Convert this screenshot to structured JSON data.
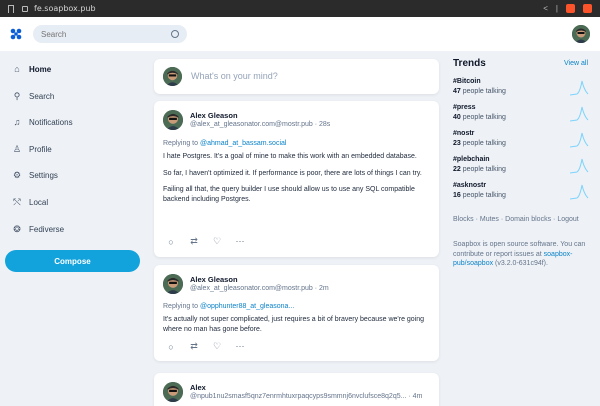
{
  "browser": {
    "url": "fe.soapbox.pub"
  },
  "search": {
    "placeholder": "Search"
  },
  "nav": [
    {
      "label": "Home",
      "icon": "home-icon",
      "glyph": "⌂"
    },
    {
      "label": "Search",
      "icon": "search-icon",
      "glyph": "⚲"
    },
    {
      "label": "Notifications",
      "icon": "bell-icon",
      "glyph": "♫"
    },
    {
      "label": "Profile",
      "icon": "user-icon",
      "glyph": "♙"
    },
    {
      "label": "Settings",
      "icon": "gear-icon",
      "glyph": "⚙"
    },
    {
      "label": "Local",
      "icon": "local-icon",
      "glyph": "⤲"
    },
    {
      "label": "Fediverse",
      "icon": "fediverse-icon",
      "glyph": "❂"
    }
  ],
  "compose_label": "Compose",
  "composer": {
    "placeholder": "What's on your mind?"
  },
  "posts": [
    {
      "name": "Alex Gleason",
      "handle": "@alex_at_gleasonator.com@mostr.pub · 28s",
      "reply_prefix": "Replying to ",
      "reply_to": "@ahmad_at_bassam.social",
      "paragraphs": [
        "I hate Postgres. It's a goal of mine to make this work with an embedded database.",
        "So far, I haven't optimized it. If performance is poor, there are lots of things I can try.",
        "Failing all that, the query builder I use should allow us to use any SQL compatible backend including Postgres."
      ]
    },
    {
      "name": "Alex Gleason",
      "handle": "@alex_at_gleasonator.com@mostr.pub · 2m",
      "reply_prefix": "Replying to ",
      "reply_to": "@opphunter88_at_gleasona...",
      "paragraphs": [
        "It's actually not super complicated, just requires a bit of bravery because we're going where no man has gone before."
      ]
    },
    {
      "name": "Alex",
      "handle": "@npub1nu2smasf5qnz7enrmhtuxrpaqcyps9smmnj6nvclufsce8q2q5... · 4m"
    }
  ],
  "trends": {
    "title": "Trends",
    "view_all": "View all",
    "items": [
      {
        "tag": "#Bitcoin",
        "count": "47",
        "suffix": " people talking"
      },
      {
        "tag": "#press",
        "count": "40",
        "suffix": " people talking"
      },
      {
        "tag": "#nostr",
        "count": "23",
        "suffix": " people talking"
      },
      {
        "tag": "#plebchain",
        "count": "22",
        "suffix": " people talking"
      },
      {
        "tag": "#asknostr",
        "count": "16",
        "suffix": " people talking"
      }
    ]
  },
  "footer": {
    "links": [
      "Blocks",
      "Mutes",
      "Domain blocks",
      "Logout"
    ],
    "about_text": "Soapbox is open source software. You can contribute or report issues at ",
    "about_link": "soapbox-pub/soapbox",
    "about_version": " (v3.2.0-631c94f)."
  },
  "colors": {
    "accent": "#12a2dc",
    "link": "#0b82c9",
    "background": "#eef2f6"
  }
}
